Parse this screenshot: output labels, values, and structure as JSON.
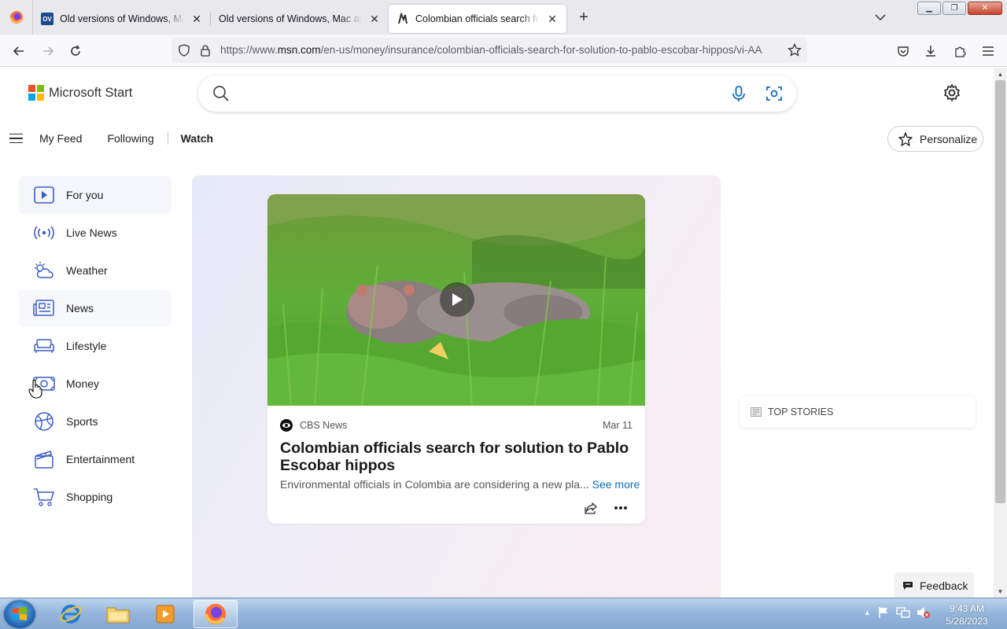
{
  "browser": {
    "tabs": [
      {
        "title": "Old versions of Windows, Mac and Linux",
        "favicon": "ov-favicon",
        "active": false
      },
      {
        "title": "Old versions of Windows, Mac and Linux",
        "favicon": "none",
        "active": false
      },
      {
        "title": "Colombian officials search for solution to Pablo Escobar hippos",
        "favicon": "msn-favicon",
        "active": true
      }
    ],
    "ov_favicon_text": "OV",
    "url_prefix": "https://www.",
    "url_domain": "msn.com",
    "url_path": "/en-us/money/insurance/colombian-officials-search-for-solution-to-pablo-escobar-hippos/vi-AA"
  },
  "header": {
    "brand": "Microsoft Start",
    "search_placeholder": "",
    "nav": {
      "my_feed": "My Feed",
      "following": "Following",
      "watch": "Watch"
    },
    "personalize": "Personalize"
  },
  "sidebar": {
    "items": [
      {
        "label": "For you",
        "icon": "play-icon",
        "selected": true
      },
      {
        "label": "Live News",
        "icon": "broadcast-icon"
      },
      {
        "label": "Weather",
        "icon": "weather-icon"
      },
      {
        "label": "News",
        "icon": "newspaper-icon",
        "hover": true
      },
      {
        "label": "Lifestyle",
        "icon": "sofa-icon"
      },
      {
        "label": "Money",
        "icon": "money-icon"
      },
      {
        "label": "Sports",
        "icon": "sports-ball-icon"
      },
      {
        "label": "Entertainment",
        "icon": "clapperboard-icon"
      },
      {
        "label": "Shopping",
        "icon": "cart-icon"
      }
    ]
  },
  "card": {
    "source": "CBS News",
    "date": "Mar 11",
    "title": "Colombian officials search for solution to Pablo Escobar hippos",
    "description": "Environmental officials in Colombia are considering a new pla...",
    "see_more": "See more"
  },
  "right": {
    "top_stories": "TOP STORIES",
    "feedback": "Feedback"
  },
  "taskbar": {
    "time": "9:43 AM",
    "date": "5/28/2023"
  },
  "colors": {
    "accent_blue": "#0f6cbd",
    "ms_red": "#f25022",
    "ms_green": "#7fba00",
    "ms_blue": "#00a4ef",
    "ms_yellow": "#ffb900"
  }
}
